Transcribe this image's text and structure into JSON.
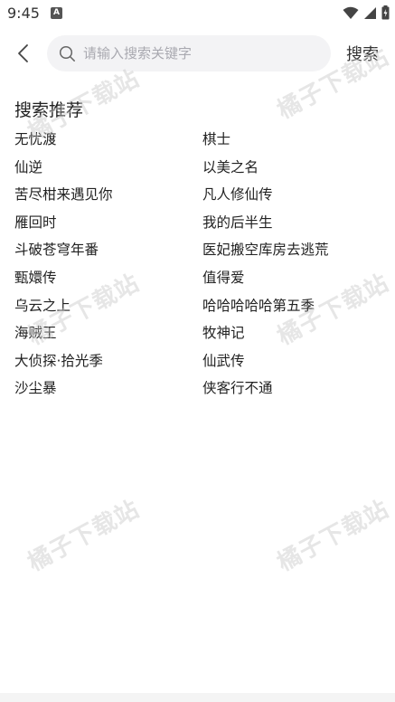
{
  "status_bar": {
    "time": "9:45",
    "notification_badge": "A"
  },
  "search": {
    "placeholder": "请输入搜索关键字",
    "button_label": "搜索"
  },
  "recommendations": {
    "title": "搜索推荐",
    "items": [
      "无忧渡",
      "棋士",
      "仙逆",
      "以美之名",
      "苦尽柑来遇见你",
      "凡人修仙传",
      "雁回时",
      "我的后半生",
      "斗破苍穹年番",
      "医妃搬空库房去逃荒",
      "甄嬛传",
      "值得爱",
      "乌云之上",
      "哈哈哈哈哈第五季",
      "海贼王",
      "牧神记",
      "大侦探·拾光季",
      "仙武传",
      "沙尘暴",
      "侠客行不通"
    ]
  },
  "watermark": {
    "text": "橘子下载站"
  }
}
